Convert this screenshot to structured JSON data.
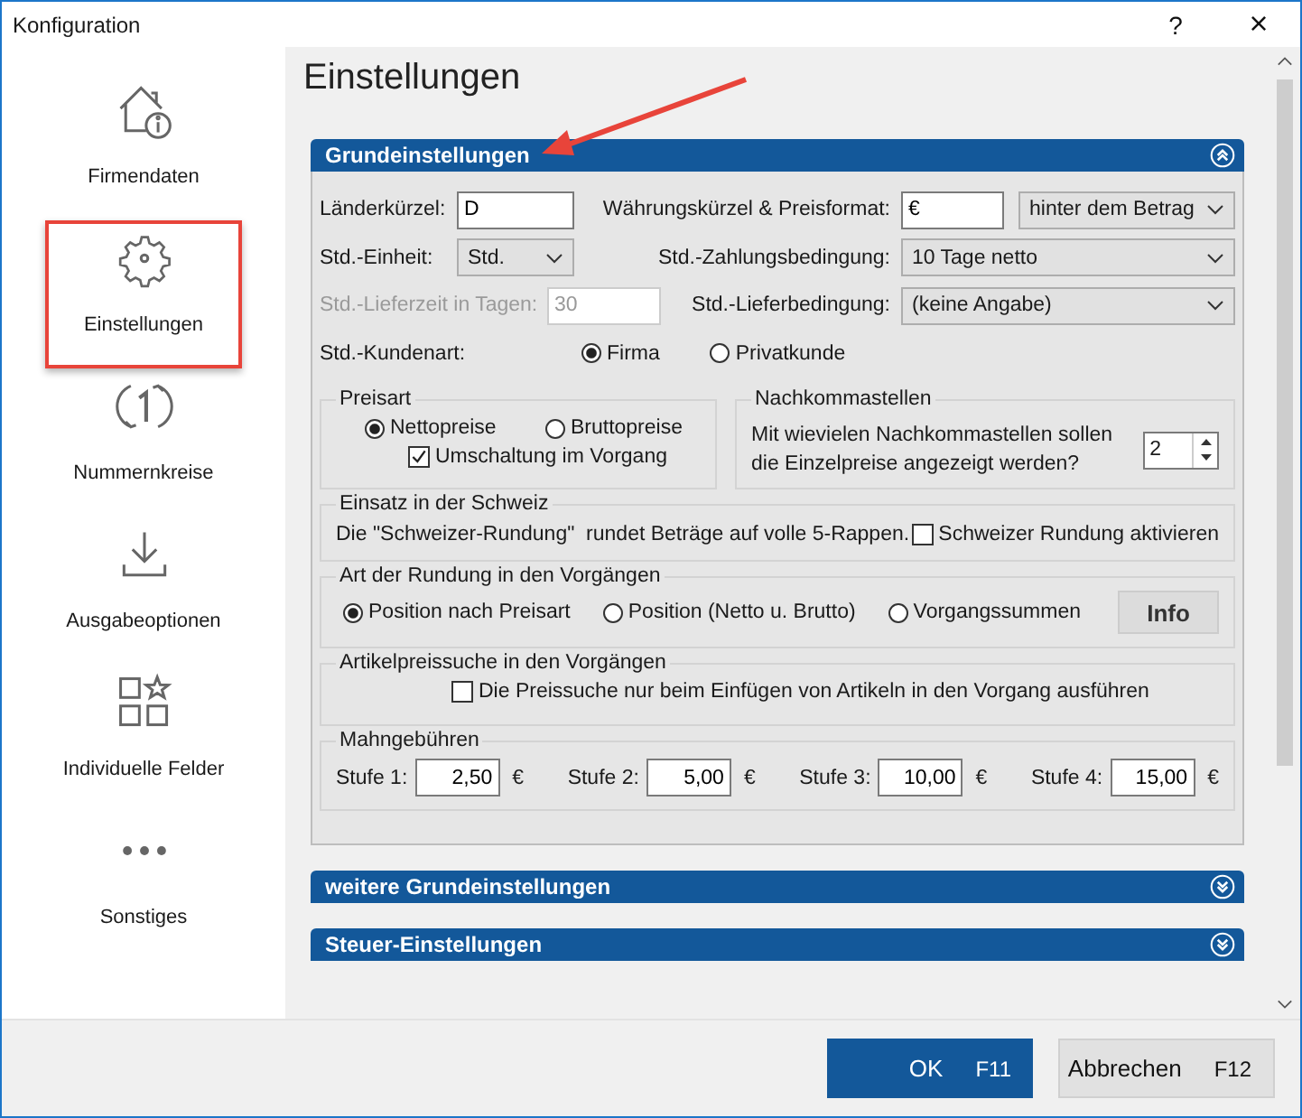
{
  "window": {
    "title": "Konfiguration",
    "help": "?",
    "close": "×"
  },
  "sidebar": {
    "items": [
      {
        "label": "Firmendaten",
        "selected": false
      },
      {
        "label": "Einstellungen",
        "selected": true
      },
      {
        "label": "Nummernkreise",
        "selected": false
      },
      {
        "label": "Ausgabeoptionen",
        "selected": false
      },
      {
        "label": "Individuelle Felder",
        "selected": false
      },
      {
        "label": "Sonstiges",
        "selected": false
      }
    ]
  },
  "heading": "Einstellungen",
  "sections": [
    {
      "title": "Grundeinstellungen",
      "expanded": true
    },
    {
      "title": "weitere Grundeinstellungen",
      "expanded": false
    },
    {
      "title": "Steuer-Einstellungen",
      "expanded": false
    }
  ],
  "grundeinstellungen": {
    "laenderkuerzel": {
      "label": "Länderkürzel:",
      "value": "D"
    },
    "waehrung": {
      "label": "Währungskürzel & Preisformat:",
      "value": "€",
      "format": "hinter dem Betrag"
    },
    "einheit": {
      "label": "Std.-Einheit:",
      "value": "Std."
    },
    "zahlung": {
      "label": "Std.-Zahlungsbedingung:",
      "value": "10 Tage netto"
    },
    "lieferzeit": {
      "label": "Std.-Lieferzeit in Tagen:",
      "value": "30",
      "disabled": true
    },
    "lieferbedingung": {
      "label": "Std.-Lieferbedingung:",
      "value": "(keine Angabe)"
    },
    "kundenart": {
      "label": "Std.-Kundenart:",
      "options": [
        {
          "label": "Firma",
          "selected": true
        },
        {
          "label": "Privatkunde",
          "selected": false
        }
      ]
    },
    "preisart": {
      "title": "Preisart",
      "options": [
        {
          "label": "Nettopreise",
          "selected": true
        },
        {
          "label": "Bruttopreise",
          "selected": false
        }
      ],
      "checkbox": {
        "label": "Umschaltung im Vorgang",
        "checked": true
      }
    },
    "nachkommastellen": {
      "title": "Nachkommastellen",
      "text": "Mit wievielen Nachkommastellen sollen die Einzelpreise angezeigt werden?",
      "value": "2"
    },
    "schweiz": {
      "title": "Einsatz in der Schweiz",
      "text": "Die \"Schweizer-Rundung\"  rundet Beträge auf volle 5-Rappen.",
      "checkbox": {
        "label": "Schweizer Rundung aktivieren",
        "checked": false
      }
    },
    "rundung": {
      "title": "Art der Rundung in den Vorgängen",
      "options": [
        {
          "label": "Position nach Preisart",
          "selected": true
        },
        {
          "label": "Position (Netto u. Brutto)",
          "selected": false
        },
        {
          "label": "Vorgangssummen",
          "selected": false
        }
      ],
      "button": "Info"
    },
    "artikelpreissuche": {
      "title": "Artikelpreissuche in den Vorgängen",
      "checkbox": {
        "label": "Die Preissuche nur beim Einfügen von Artikeln in den Vorgang ausführen",
        "checked": false
      }
    },
    "mahngebuehren": {
      "title": "Mahngebühren",
      "levels": [
        {
          "label": "Stufe 1:",
          "value": "2,50",
          "unit": "€"
        },
        {
          "label": "Stufe 2:",
          "value": "5,00",
          "unit": "€"
        },
        {
          "label": "Stufe 3:",
          "value": "10,00",
          "unit": "€"
        },
        {
          "label": "Stufe 4:",
          "value": "15,00",
          "unit": "€"
        }
      ]
    }
  },
  "buttons": [
    {
      "label": "OK",
      "shortcut": "F11",
      "kind": "primary"
    },
    {
      "label": "Abbrechen",
      "shortcut": "F12",
      "kind": "secondary"
    }
  ]
}
